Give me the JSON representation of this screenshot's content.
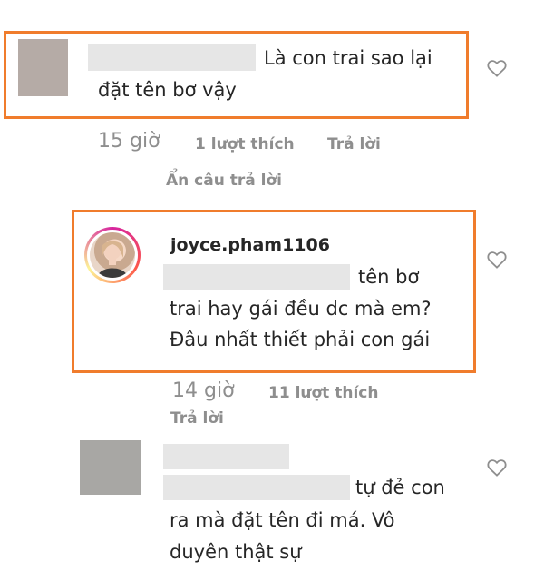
{
  "comment1": {
    "text_line1": "Là con trai sao lại",
    "text_line2": "đặt tên bơ vậy",
    "time": "15 giờ",
    "likes": "1 lượt thích",
    "reply": "Trả lời",
    "avatar_color": "#b5aba6"
  },
  "hide_replies": "Ẩn câu trả lời",
  "reply1": {
    "username": "joyce.pham1106",
    "text_line1": "tên bơ",
    "text_line2": "trai hay gái đều dc mà em?",
    "text_line3": "Đâu nhất thiết phải con gái",
    "time": "14 giờ",
    "likes": "11 lượt thích",
    "reply": "Trả lời"
  },
  "comment2": {
    "text_line1": "tự đẻ con",
    "text_line2": "ra mà đặt tên đi má. Vô",
    "text_line3": "duyên thật sự",
    "avatar_color": "#a8a7a4"
  },
  "colors": {
    "highlight": "#f07c2c",
    "meta_gray": "#8e8e8e",
    "text": "#262626"
  }
}
